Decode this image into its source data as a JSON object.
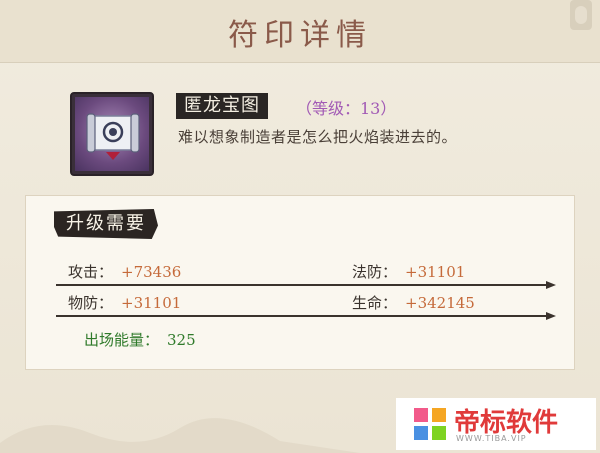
{
  "header": {
    "title": "符印详情"
  },
  "item": {
    "name": "匿龙宝图",
    "level": "（等级：13）",
    "description": "难以想象制造者是怎么把火焰装进去的。",
    "icon": "scroll-icon"
  },
  "upgrade": {
    "title": "升级需要",
    "stats": [
      {
        "label": "攻击：",
        "value": "+73436"
      },
      {
        "label": "法防：",
        "value": "+31101"
      },
      {
        "label": "物防：",
        "value": "+31101"
      },
      {
        "label": "生命：",
        "value": "+342145"
      }
    ],
    "energy": {
      "label": "出场能量：",
      "value": "325"
    }
  },
  "watermark": {
    "text": "帝标软件",
    "sub": "WWW.TIBA.VIP"
  },
  "colors": {
    "title": "#8a5a4a",
    "level": "#a25ab5",
    "stat_value": "#c56a3a",
    "energy": "#2f7a2a",
    "watermark": "#e03a3a"
  }
}
